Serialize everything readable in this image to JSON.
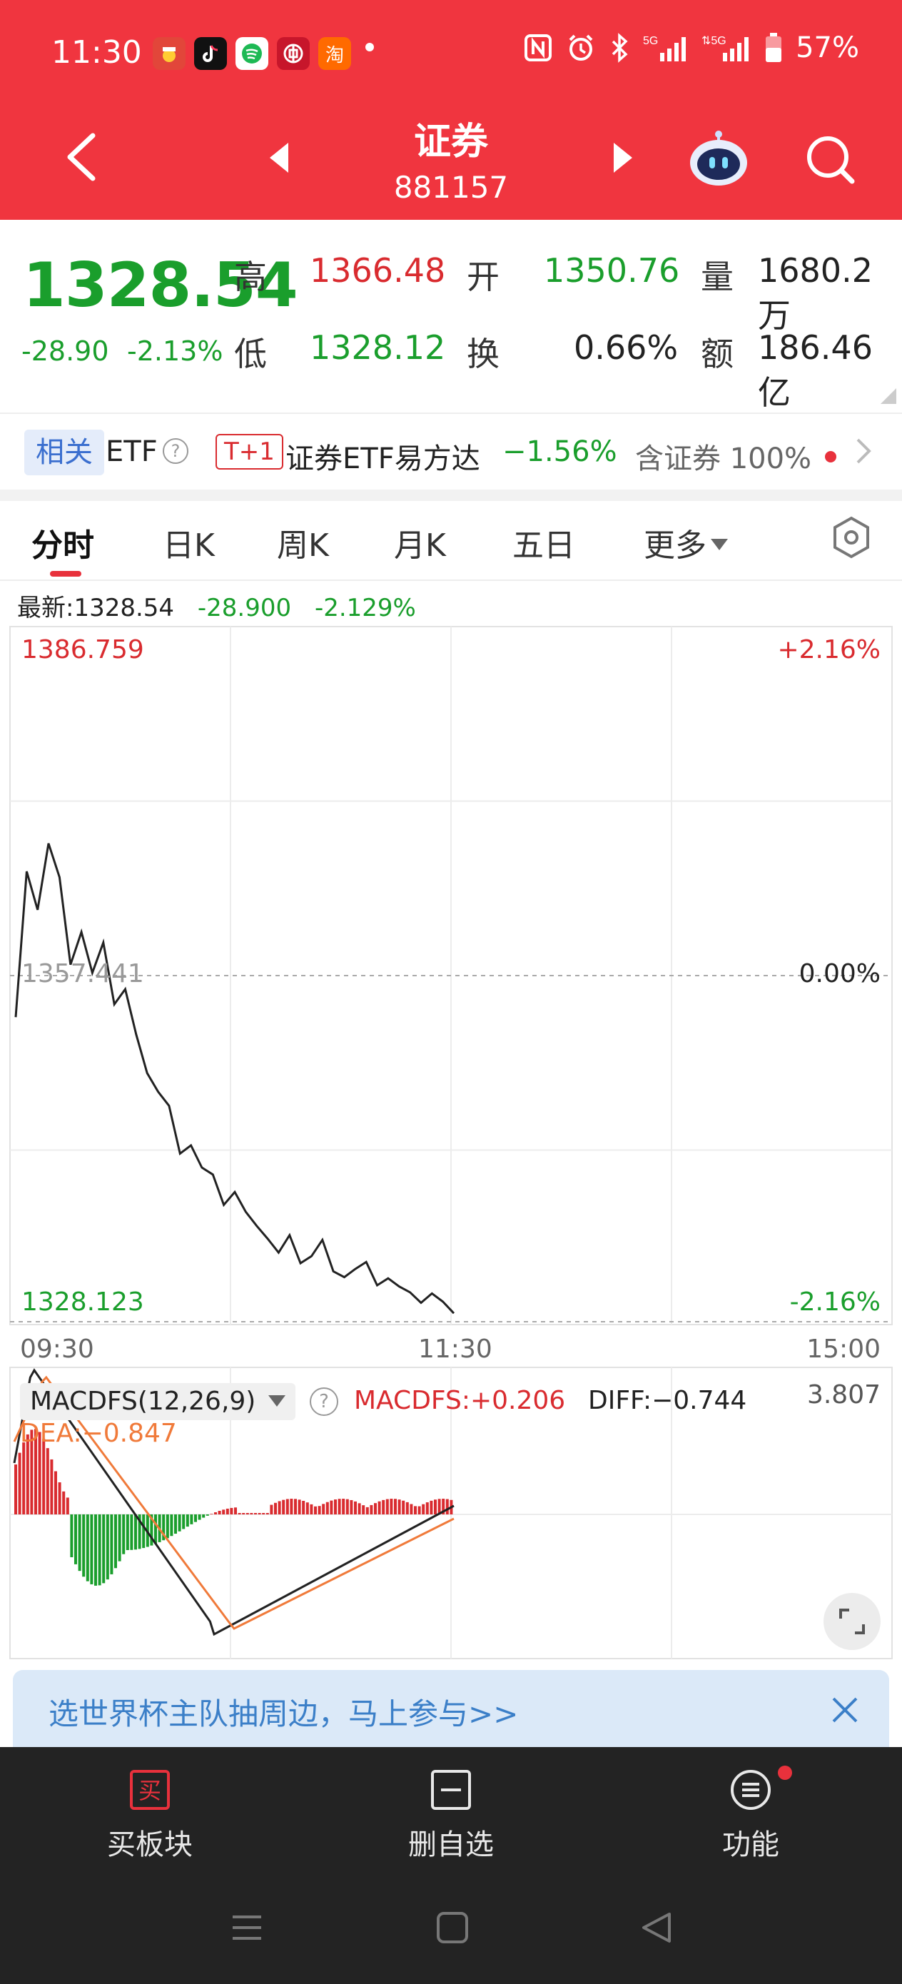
{
  "status_bar": {
    "time": "11:30",
    "app_icons": [
      "app-icon-1",
      "tiktok-icon",
      "chat-icon",
      "bank-icon",
      "taobao-icon"
    ],
    "taobao_glyph": "淘",
    "network": "5G",
    "battery": "57%"
  },
  "header": {
    "title": "证券",
    "code": "881157"
  },
  "quote": {
    "price": "1328.54",
    "change": "-28.90",
    "change_pct": "-2.13%",
    "high_label": "高",
    "high_value": "1366.48",
    "open_label": "开",
    "open_value": "1350.76",
    "volume_label": "量",
    "volume_value": "1680.2万",
    "low_label": "低",
    "low_value": "1328.12",
    "turnover_label": "换",
    "turnover_value": "0.66%",
    "amount_label": "额",
    "amount_value": "186.46亿"
  },
  "etf": {
    "related_badge": "相关",
    "label": "ETF",
    "help_glyph": "?",
    "t1_badge": "T+1",
    "name": "证券ETF易方达",
    "change": "−1.56%",
    "contain_text": "含证券 100%"
  },
  "tabs": [
    {
      "label": "分时"
    },
    {
      "label": "日K"
    },
    {
      "label": "周K"
    },
    {
      "label": "月K"
    },
    {
      "label": "五日"
    },
    {
      "label": "更多"
    }
  ],
  "info": {
    "latest": "最新:1328.54",
    "change": "-28.900",
    "change_pct": "-2.129%"
  },
  "chart_data": {
    "type": "line",
    "title": "",
    "top_price_label": "1386.759",
    "top_pct_label": "+2.16%",
    "mid_price_label": "1357.441",
    "mid_pct_label": "0.00%",
    "bottom_price_label": "1328.123",
    "bottom_pct_label": "-2.16%",
    "x_labels": [
      "09:30",
      "11:30",
      "15:00"
    ],
    "ylim": [
      1328.123,
      1386.759
    ],
    "prev_close": 1357.441,
    "x": [
      0,
      2,
      4,
      6,
      8,
      10,
      12,
      14,
      16,
      18,
      20,
      22,
      24,
      26,
      28,
      30,
      32,
      34,
      36,
      38,
      40,
      42,
      44,
      46,
      48,
      50,
      52,
      54,
      56,
      58,
      60,
      62,
      64,
      66,
      68,
      70,
      72,
      74,
      76,
      78,
      80,
      82,
      84,
      86,
      88,
      90,
      92,
      94,
      96,
      98,
      100,
      102,
      104,
      106,
      108,
      110,
      112,
      114,
      116,
      118,
      120
    ],
    "price": [
      1354.0,
      1366.5,
      1363.2,
      1368.9,
      1366.0,
      1358.5,
      1361.3,
      1357.8,
      1360.4,
      1355.1,
      1356.4,
      1352.5,
      1349.2,
      1347.6,
      1346.4,
      1342.3,
      1343.0,
      1341.1,
      1340.5,
      1337.9,
      1339.0,
      1337.3,
      1336.1,
      1335.0,
      1333.8,
      1335.3,
      1332.9,
      1333.5,
      1334.9,
      1332.2,
      1331.7,
      1332.4,
      1333.0,
      1331.0,
      1331.6,
      1330.9,
      1330.4,
      1329.5,
      1330.3,
      1329.6,
      1328.6
    ],
    "macd": {
      "label": "MACDFS(12,26,9)",
      "value_label": "MACDFS:+0.206",
      "diff_label": "DIFF:−0.744",
      "dea_label": "DEA:−0.847",
      "max_label": "3.807"
    }
  },
  "banner": {
    "text": "选世界杯主队抽周边，马上参与>>"
  },
  "bottom_bar": {
    "buy_icon_glyph": "买",
    "buy": "买板块",
    "remove_watch": "删自选",
    "functions": "功能"
  }
}
